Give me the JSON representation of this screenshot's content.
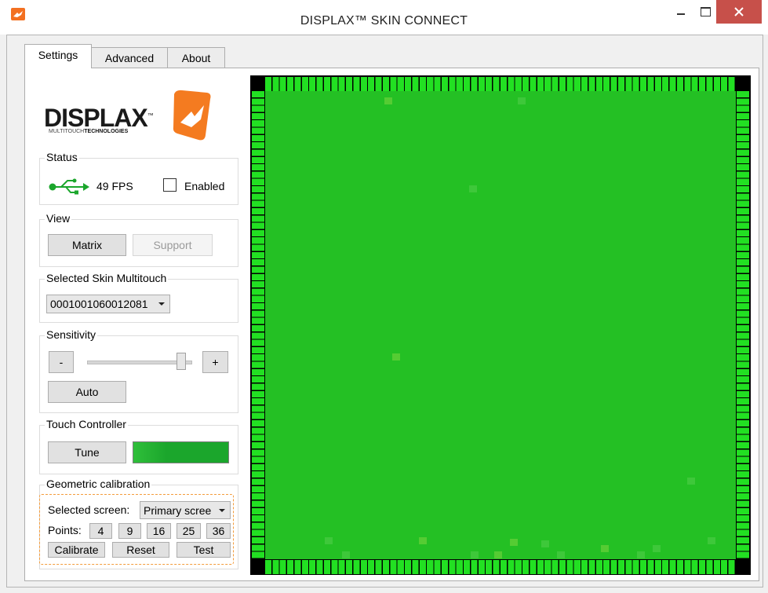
{
  "window": {
    "title": "DISPLAX™ SKIN CONNECT",
    "icon": "displax-app-icon",
    "controls": [
      "minimize-icon",
      "maximize-icon",
      "close-icon"
    ]
  },
  "tabs": [
    {
      "label": "Settings",
      "active": true
    },
    {
      "label": "Advanced",
      "active": false
    },
    {
      "label": "About",
      "active": false
    }
  ],
  "logo": {
    "text": "DISPLAX",
    "trademark": "™",
    "subtitle_prefix": "MULTITOUCH",
    "subtitle_bold": "TECHNOLOGIES"
  },
  "status": {
    "title": "Status",
    "icon": "usb-icon",
    "fps": "49 FPS",
    "enabled_label": "Enabled",
    "enabled_checked": false
  },
  "view": {
    "title": "View",
    "matrix_label": "Matrix",
    "support_label": "Support"
  },
  "skin": {
    "title": "Selected Skin Multitouch",
    "selected": "0001001060012081"
  },
  "sensitivity": {
    "title": "Sensitivity",
    "minus_label": "-",
    "plus_label": "+",
    "auto_label": "Auto",
    "level_fraction": 0.93
  },
  "touch_controller": {
    "title": "Touch Controller",
    "tune_label": "Tune",
    "signal_color": "#1ba62c"
  },
  "geometric_calibration": {
    "title": "Geometric calibration",
    "screen_label": "Selected screen:",
    "screen_value": "Primary scree",
    "points_label": "Points:",
    "points": [
      "4",
      "9",
      "16",
      "25",
      "36"
    ],
    "calibrate_label": "Calibrate",
    "reset_label": "Reset",
    "test_label": "Test"
  },
  "matrix_view": {
    "columns": 64,
    "rows": 64,
    "field_color": "#24c024",
    "tick_color": "#22e022"
  }
}
